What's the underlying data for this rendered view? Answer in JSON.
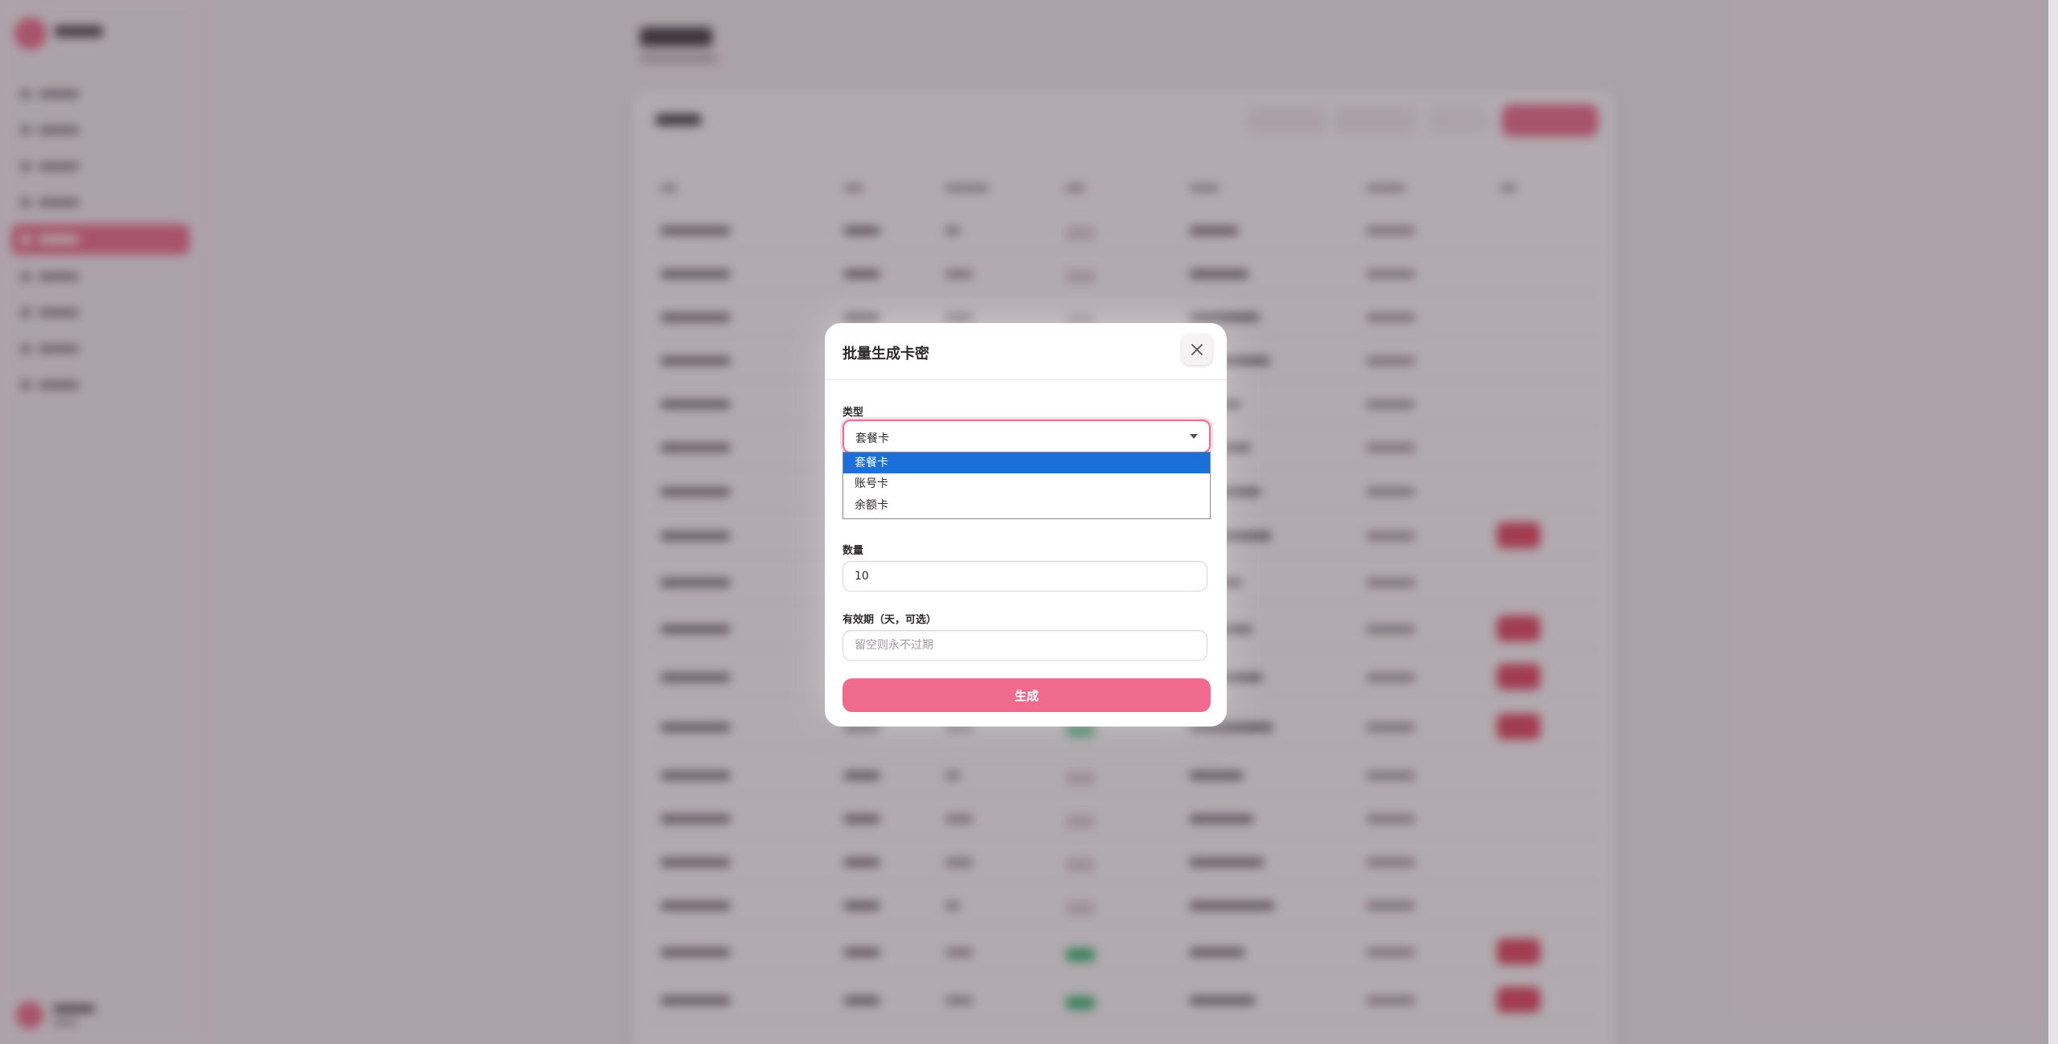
{
  "modal": {
    "title": "批量生成卡密",
    "type_label": "类型",
    "type_selected": "套餐卡",
    "type_options": [
      "套餐卡",
      "账号卡",
      "余额卡"
    ],
    "quantity_label": "数量",
    "quantity_value": "10",
    "validity_label": "有效期（天，可选）",
    "validity_placeholder": "留空则永不过期",
    "submit_label": "生成"
  },
  "colors": {
    "accent": "#f06a8e",
    "selected_option": "#1a6fd9",
    "delete": "#e3425f",
    "status_green": "#34b873"
  },
  "icons": {
    "close": "close-icon",
    "dropdown": "chevron-down-icon"
  }
}
